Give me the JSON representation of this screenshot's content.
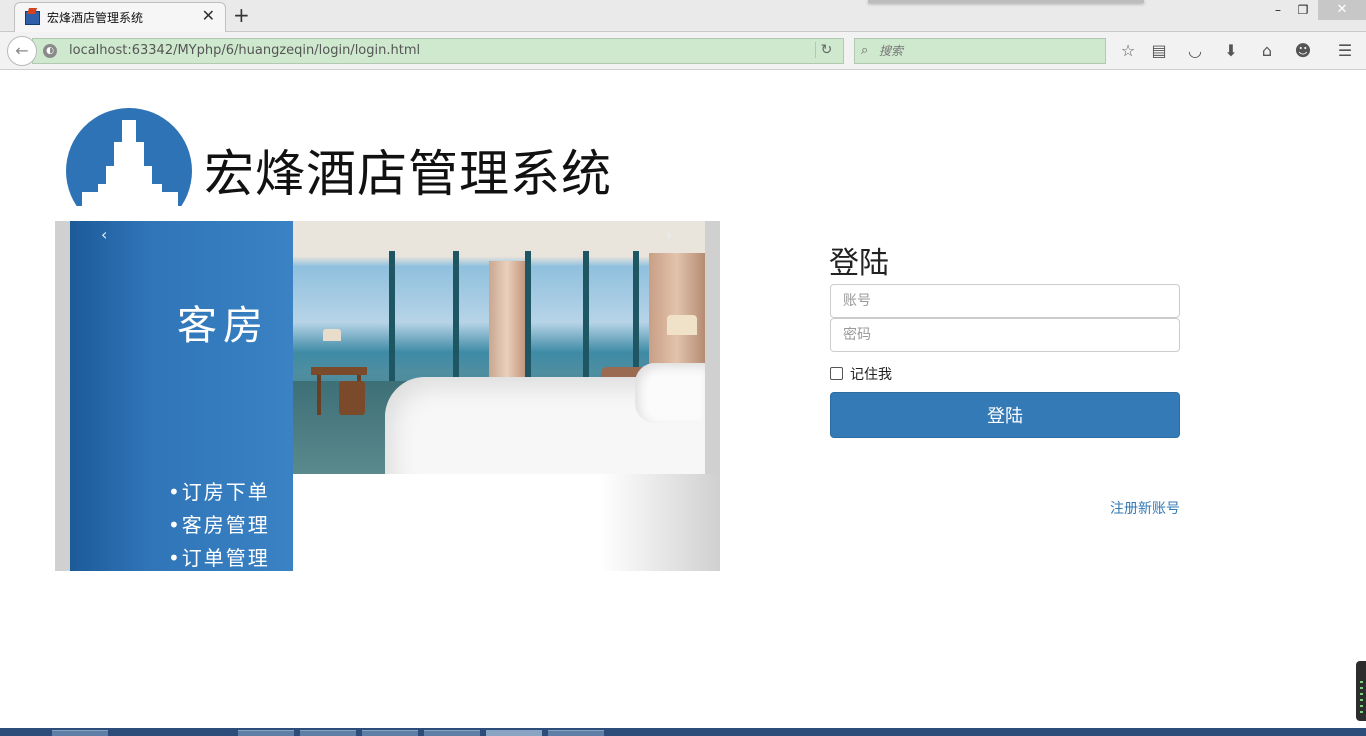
{
  "browser": {
    "tab_title": "宏烽酒店管理系统",
    "tab_close": "✕",
    "new_tab": "+",
    "url": "localhost:63342/MYphp/6/huangzeqin/login/login.html",
    "search_placeholder": "搜索",
    "window_minimize": "–",
    "window_restore": "❐",
    "window_close": "✕"
  },
  "header": {
    "logo_text": "宏烽酒店管理系统"
  },
  "carousel": {
    "prev": "‹",
    "next": "›",
    "panel_title": "客房",
    "items": [
      "•订房下单",
      "•客房管理",
      "•订单管理"
    ]
  },
  "login": {
    "title": "登陆",
    "account_placeholder": "账号",
    "password_placeholder": "密码",
    "remember_label": "记住我",
    "submit_label": "登陆",
    "register_link": "注册新账号"
  },
  "colors": {
    "primary": "#337ab7",
    "panel_blue": "#2e73b5",
    "url_bar_green": "#cfe9cf"
  }
}
